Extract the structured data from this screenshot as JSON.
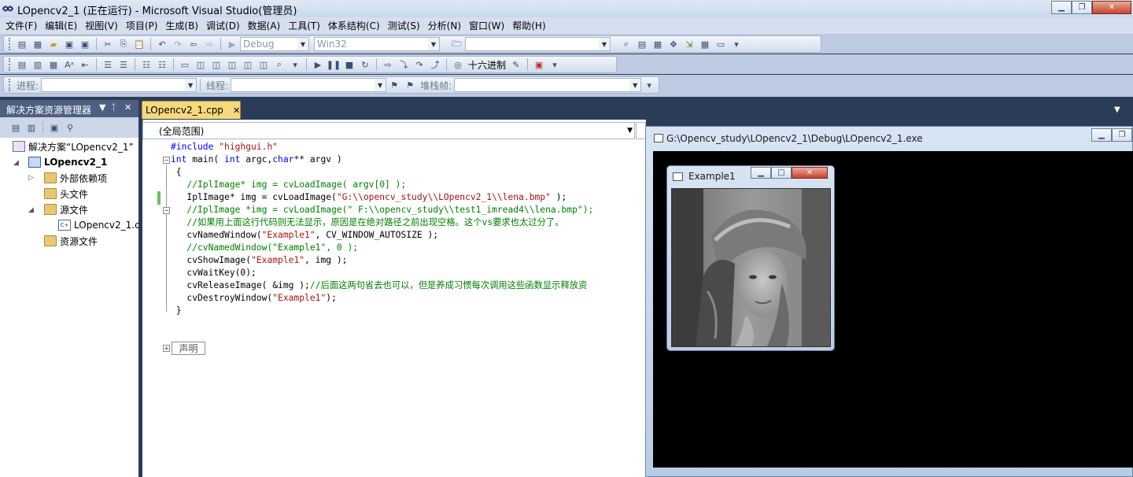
{
  "window": {
    "title": "LOpencv2_1 (正在运行) - Microsoft Visual Studio(管理员)"
  },
  "menu": [
    "文件(F)",
    "编辑(E)",
    "视图(V)",
    "项目(P)",
    "生成(B)",
    "调试(D)",
    "数据(A)",
    "工具(T)",
    "体系结构(C)",
    "测试(S)",
    "分析(N)",
    "窗口(W)",
    "帮助(H)"
  ],
  "toolbar1": {
    "config": "Debug",
    "platform": "Win32",
    "find_value": ""
  },
  "toolbar2": {
    "hex_label": "十六进制"
  },
  "toolbar3": {
    "process_label": "进程:",
    "thread_label": "线程:",
    "stackframe_label": "堆栈帧:"
  },
  "solution_explorer": {
    "title": "解决方案资源管理器",
    "items": [
      {
        "label": "解决方案“LOpencv2_1”"
      },
      {
        "label": "LOpencv2_1"
      },
      {
        "label": "外部依赖项"
      },
      {
        "label": "头文件"
      },
      {
        "label": "源文件"
      },
      {
        "label": "LOpencv2_1.c"
      },
      {
        "label": "资源文件"
      }
    ]
  },
  "editor": {
    "tab": "LOpencv2_1.cpp",
    "scope": "(全局范围)",
    "collapsed_region": "声明"
  },
  "console": {
    "title": "G:\\Opencv_study\\LOpencv2_1\\Debug\\LOpencv2_1.exe"
  },
  "image_window": {
    "title": "Example1"
  },
  "colors": {
    "keyword": "#0000ff",
    "comment": "#008000",
    "string": "#a31515",
    "dock_bg": "#2b3c59"
  }
}
